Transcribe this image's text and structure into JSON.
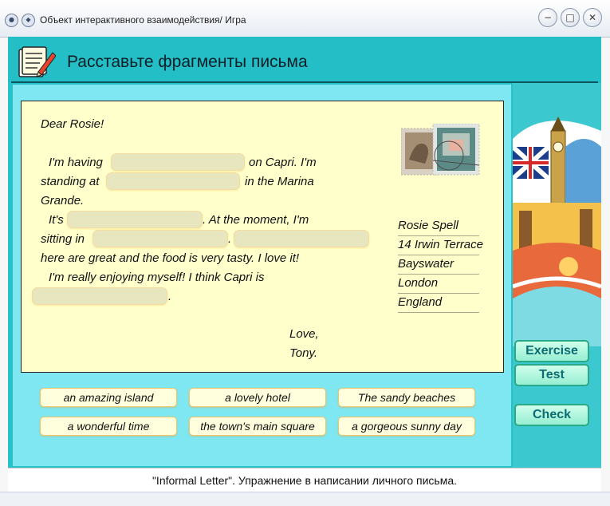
{
  "window": {
    "title": "Объект интерактивного взаимодействия/ Игра"
  },
  "header": {
    "title": "Расставьте фрагменты письма",
    "icon": "notebook-pencil-icon"
  },
  "letter": {
    "greeting": "Dear Rosie!",
    "line1a": "I'm having",
    "line1b": "on Capri. I'm",
    "line2a": "standing at",
    "line2b": "in the Marina",
    "line3": "Grande.",
    "line4a": "It's",
    "line4b": ". At the moment, I'm",
    "line5a": "sitting in",
    "line5b": ".",
    "line6": "here are great and the food is very tasty. I love it!",
    "line7": "I'm really enjoying myself! I think Capri is",
    "line8": ".",
    "closing1": "Love,",
    "closing2": "Tony.",
    "address": [
      "Rosie Spell",
      "14 Irwin Terrace",
      "Bayswater",
      "London",
      "England"
    ]
  },
  "fragments": [
    "an amazing island",
    "a lovely hotel",
    "The sandy beaches",
    "a wonderful time",
    "the town's main square",
    "a gorgeous sunny day"
  ],
  "buttons": {
    "exercise": "Exercise",
    "test": "Test",
    "check": "Check"
  },
  "status": "\"Informal Letter\". Упражнение в написании личного письма.",
  "colors": {
    "accent": "#24bfc6",
    "work_area": "#7fe7f1",
    "letter_bg": "#ffffcc",
    "button_text": "#0d6c72"
  }
}
